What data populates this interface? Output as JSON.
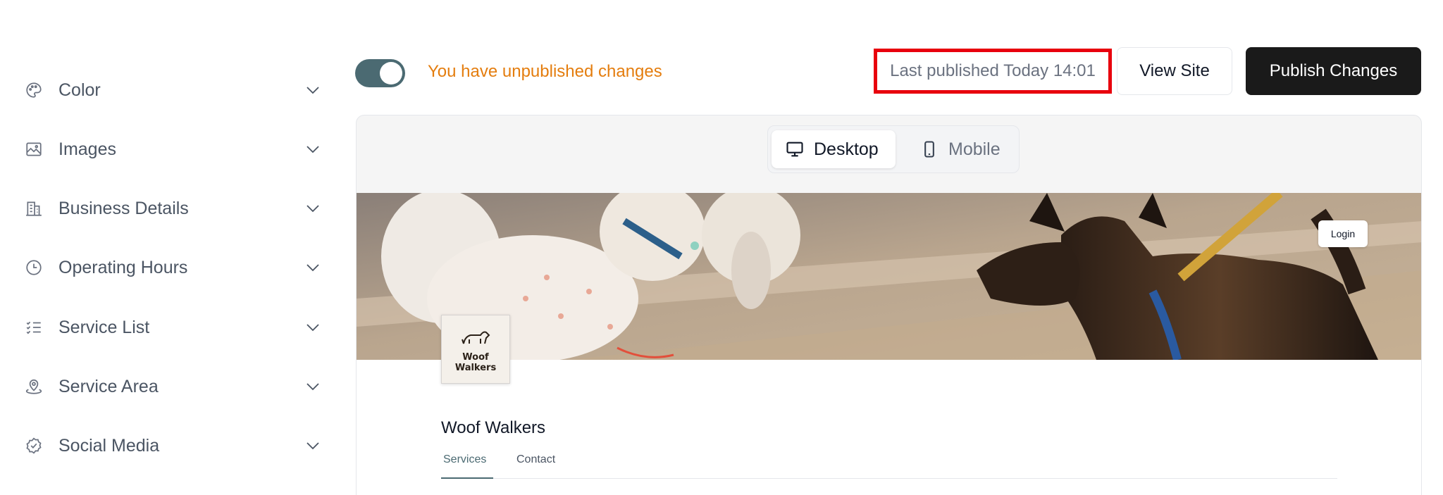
{
  "sidebar": {
    "items": [
      {
        "label": "Color",
        "icon": "palette-icon"
      },
      {
        "label": "Images",
        "icon": "image-icon"
      },
      {
        "label": "Business Details",
        "icon": "building-icon"
      },
      {
        "label": "Operating Hours",
        "icon": "clock-icon"
      },
      {
        "label": "Service List",
        "icon": "checklist-icon"
      },
      {
        "label": "Service Area",
        "icon": "location-pin-icon"
      },
      {
        "label": "Social Media",
        "icon": "badge-check-icon"
      }
    ]
  },
  "topbar": {
    "toggle_on": true,
    "unpublished_text": "You have unpublished changes",
    "last_published": "Last published Today 14:01",
    "view_site_label": "View Site",
    "publish_label": "Publish Changes"
  },
  "preview": {
    "device_switch": {
      "desktop_label": "Desktop",
      "mobile_label": "Mobile",
      "selected": "Desktop"
    },
    "site": {
      "login_label": "Login",
      "logo_text_line1": "Woof",
      "logo_text_line2": "Walkers",
      "business_name": "Woof Walkers",
      "tabs": [
        {
          "label": "Services",
          "active": true
        },
        {
          "label": "Contact",
          "active": false
        }
      ]
    }
  },
  "colors": {
    "accent_teal": "#4b6a72",
    "warning_orange": "#e47d0e",
    "highlight_red": "#e8000d",
    "publish_button_bg": "#1a1a1a"
  }
}
